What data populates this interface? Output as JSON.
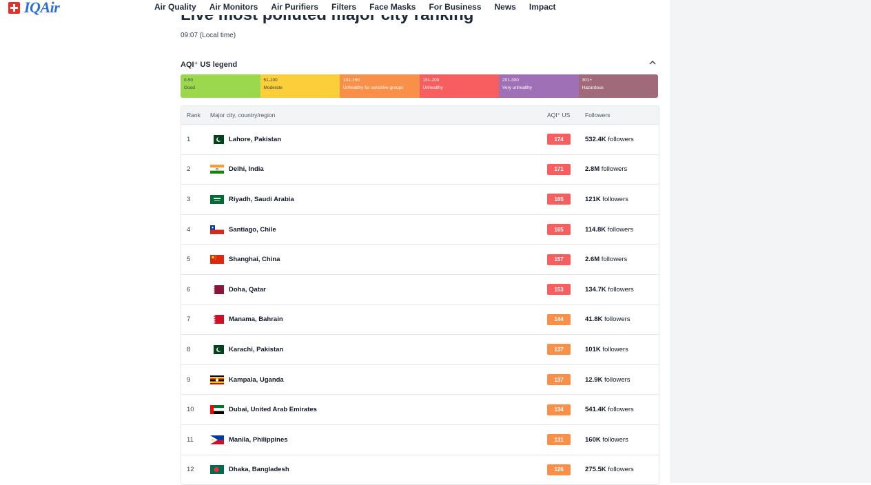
{
  "header": {
    "logo_text": "IQAir",
    "nav": [
      "Air Quality",
      "Air Monitors",
      "Air Purifiers",
      "Filters",
      "Face Masks",
      "For Business",
      "News",
      "Impact"
    ]
  },
  "page": {
    "title": "Live most polluted major city ranking",
    "local_time": "09:07 (Local time)"
  },
  "legend": {
    "title": "AQI⁺ US legend",
    "segments": [
      {
        "range": "0-50",
        "label": "Good",
        "color": "#9cd84e",
        "dark": true
      },
      {
        "range": "51-100",
        "label": "Moderate",
        "color": "#facf39",
        "dark": true
      },
      {
        "range": "101-150",
        "label": "Unhealthy for sensitive groups",
        "color": "#f99049",
        "dark": false
      },
      {
        "range": "151-200",
        "label": "Unhealthy",
        "color": "#f65e5f",
        "dark": false
      },
      {
        "range": "201-300",
        "label": "Very unhealthy",
        "color": "#a070b6",
        "dark": false
      },
      {
        "range": "301+",
        "label": "Hazardous",
        "color": "#a06a7b",
        "dark": false
      }
    ]
  },
  "table": {
    "headers": {
      "rank": "Rank",
      "city": "Major city, country/region",
      "aqi": "AQI⁺ US",
      "followers": "Followers"
    },
    "followers_suffix": "followers",
    "rows": [
      {
        "rank": "1",
        "city": "Lahore, Pakistan",
        "flag": "pakistan-flag-icon",
        "aqi": "174",
        "aqi_color": "#f65e5f",
        "followers": "532.4K"
      },
      {
        "rank": "2",
        "city": "Delhi, India",
        "flag": "india-flag-icon",
        "aqi": "171",
        "aqi_color": "#f65e5f",
        "followers": "2.8M"
      },
      {
        "rank": "3",
        "city": "Riyadh, Saudi Arabia",
        "flag": "saudi-arabia-flag-icon",
        "aqi": "165",
        "aqi_color": "#f65e5f",
        "followers": "121K"
      },
      {
        "rank": "4",
        "city": "Santiago, Chile",
        "flag": "chile-flag-icon",
        "aqi": "165",
        "aqi_color": "#f65e5f",
        "followers": "114.8K"
      },
      {
        "rank": "5",
        "city": "Shanghai, China",
        "flag": "china-flag-icon",
        "aqi": "157",
        "aqi_color": "#f65e5f",
        "followers": "2.6M"
      },
      {
        "rank": "6",
        "city": "Doha, Qatar",
        "flag": "qatar-flag-icon",
        "aqi": "153",
        "aqi_color": "#f65e5f",
        "followers": "134.7K"
      },
      {
        "rank": "7",
        "city": "Manama, Bahrain",
        "flag": "bahrain-flag-icon",
        "aqi": "144",
        "aqi_color": "#f99049",
        "followers": "41.8K"
      },
      {
        "rank": "8",
        "city": "Karachi, Pakistan",
        "flag": "pakistan-flag-icon",
        "aqi": "137",
        "aqi_color": "#f99049",
        "followers": "101K"
      },
      {
        "rank": "9",
        "city": "Kampala, Uganda",
        "flag": "uganda-flag-icon",
        "aqi": "137",
        "aqi_color": "#f99049",
        "followers": "12.9K"
      },
      {
        "rank": "10",
        "city": "Dubai, United Arab Emirates",
        "flag": "uae-flag-icon",
        "aqi": "134",
        "aqi_color": "#f99049",
        "followers": "541.4K"
      },
      {
        "rank": "11",
        "city": "Manila, Philippines",
        "flag": "philippines-flag-icon",
        "aqi": "131",
        "aqi_color": "#f99049",
        "followers": "160K"
      },
      {
        "rank": "12",
        "city": "Dhaka, Bangladesh",
        "flag": "bangladesh-flag-icon",
        "aqi": "126",
        "aqi_color": "#f99049",
        "followers": "275.5K"
      }
    ]
  }
}
